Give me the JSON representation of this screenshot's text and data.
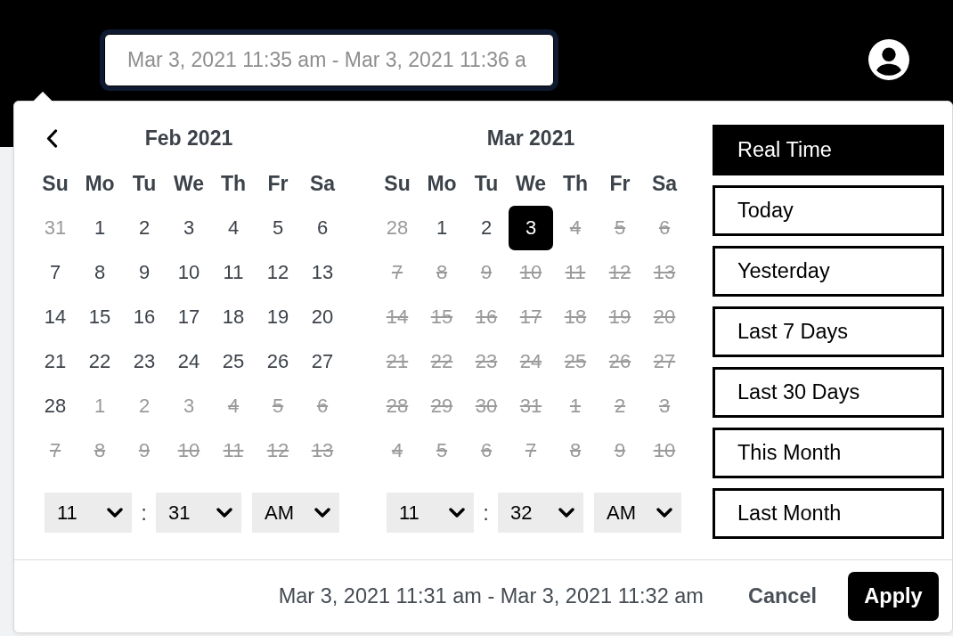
{
  "header": {
    "range_field": {
      "placeholder": "Mar 3, 2021 11:35 am - Mar 3, 2021 11:36 a"
    }
  },
  "picker": {
    "calendars": [
      {
        "has_prev": true,
        "title": "Feb 2021",
        "weekdays": [
          "Su",
          "Mo",
          "Tu",
          "We",
          "Th",
          "Fr",
          "Sa"
        ],
        "days": [
          {
            "label": "31",
            "outside": true,
            "disabled": false,
            "selected": false
          },
          {
            "label": "1",
            "outside": false,
            "disabled": false,
            "selected": false
          },
          {
            "label": "2",
            "outside": false,
            "disabled": false,
            "selected": false
          },
          {
            "label": "3",
            "outside": false,
            "disabled": false,
            "selected": false
          },
          {
            "label": "4",
            "outside": false,
            "disabled": false,
            "selected": false
          },
          {
            "label": "5",
            "outside": false,
            "disabled": false,
            "selected": false
          },
          {
            "label": "6",
            "outside": false,
            "disabled": false,
            "selected": false
          },
          {
            "label": "7",
            "outside": false,
            "disabled": false,
            "selected": false
          },
          {
            "label": "8",
            "outside": false,
            "disabled": false,
            "selected": false
          },
          {
            "label": "9",
            "outside": false,
            "disabled": false,
            "selected": false
          },
          {
            "label": "10",
            "outside": false,
            "disabled": false,
            "selected": false
          },
          {
            "label": "11",
            "outside": false,
            "disabled": false,
            "selected": false
          },
          {
            "label": "12",
            "outside": false,
            "disabled": false,
            "selected": false
          },
          {
            "label": "13",
            "outside": false,
            "disabled": false,
            "selected": false
          },
          {
            "label": "14",
            "outside": false,
            "disabled": false,
            "selected": false
          },
          {
            "label": "15",
            "outside": false,
            "disabled": false,
            "selected": false
          },
          {
            "label": "16",
            "outside": false,
            "disabled": false,
            "selected": false
          },
          {
            "label": "17",
            "outside": false,
            "disabled": false,
            "selected": false
          },
          {
            "label": "18",
            "outside": false,
            "disabled": false,
            "selected": false
          },
          {
            "label": "19",
            "outside": false,
            "disabled": false,
            "selected": false
          },
          {
            "label": "20",
            "outside": false,
            "disabled": false,
            "selected": false
          },
          {
            "label": "21",
            "outside": false,
            "disabled": false,
            "selected": false
          },
          {
            "label": "22",
            "outside": false,
            "disabled": false,
            "selected": false
          },
          {
            "label": "23",
            "outside": false,
            "disabled": false,
            "selected": false
          },
          {
            "label": "24",
            "outside": false,
            "disabled": false,
            "selected": false
          },
          {
            "label": "25",
            "outside": false,
            "disabled": false,
            "selected": false
          },
          {
            "label": "26",
            "outside": false,
            "disabled": false,
            "selected": false
          },
          {
            "label": "27",
            "outside": false,
            "disabled": false,
            "selected": false
          },
          {
            "label": "28",
            "outside": false,
            "disabled": false,
            "selected": false
          },
          {
            "label": "1",
            "outside": true,
            "disabled": false,
            "selected": false
          },
          {
            "label": "2",
            "outside": true,
            "disabled": false,
            "selected": false
          },
          {
            "label": "3",
            "outside": true,
            "disabled": false,
            "selected": false
          },
          {
            "label": "4",
            "outside": true,
            "disabled": true,
            "selected": false
          },
          {
            "label": "5",
            "outside": true,
            "disabled": true,
            "selected": false
          },
          {
            "label": "6",
            "outside": true,
            "disabled": true,
            "selected": false
          },
          {
            "label": "7",
            "outside": true,
            "disabled": true,
            "selected": false
          },
          {
            "label": "8",
            "outside": true,
            "disabled": true,
            "selected": false
          },
          {
            "label": "9",
            "outside": true,
            "disabled": true,
            "selected": false
          },
          {
            "label": "10",
            "outside": true,
            "disabled": true,
            "selected": false
          },
          {
            "label": "11",
            "outside": true,
            "disabled": true,
            "selected": false
          },
          {
            "label": "12",
            "outside": true,
            "disabled": true,
            "selected": false
          },
          {
            "label": "13",
            "outside": true,
            "disabled": true,
            "selected": false
          }
        ],
        "time": {
          "hour": "11",
          "separator": ":",
          "minute": "31",
          "period": "AM"
        }
      },
      {
        "has_prev": false,
        "title": "Mar 2021",
        "weekdays": [
          "Su",
          "Mo",
          "Tu",
          "We",
          "Th",
          "Fr",
          "Sa"
        ],
        "days": [
          {
            "label": "28",
            "outside": true,
            "disabled": false,
            "selected": false
          },
          {
            "label": "1",
            "outside": false,
            "disabled": false,
            "selected": false
          },
          {
            "label": "2",
            "outside": false,
            "disabled": false,
            "selected": false
          },
          {
            "label": "3",
            "outside": false,
            "disabled": false,
            "selected": true
          },
          {
            "label": "4",
            "outside": false,
            "disabled": true,
            "selected": false
          },
          {
            "label": "5",
            "outside": false,
            "disabled": true,
            "selected": false
          },
          {
            "label": "6",
            "outside": false,
            "disabled": true,
            "selected": false
          },
          {
            "label": "7",
            "outside": false,
            "disabled": true,
            "selected": false
          },
          {
            "label": "8",
            "outside": false,
            "disabled": true,
            "selected": false
          },
          {
            "label": "9",
            "outside": false,
            "disabled": true,
            "selected": false
          },
          {
            "label": "10",
            "outside": false,
            "disabled": true,
            "selected": false
          },
          {
            "label": "11",
            "outside": false,
            "disabled": true,
            "selected": false
          },
          {
            "label": "12",
            "outside": false,
            "disabled": true,
            "selected": false
          },
          {
            "label": "13",
            "outside": false,
            "disabled": true,
            "selected": false
          },
          {
            "label": "14",
            "outside": false,
            "disabled": true,
            "selected": false
          },
          {
            "label": "15",
            "outside": false,
            "disabled": true,
            "selected": false
          },
          {
            "label": "16",
            "outside": false,
            "disabled": true,
            "selected": false
          },
          {
            "label": "17",
            "outside": false,
            "disabled": true,
            "selected": false
          },
          {
            "label": "18",
            "outside": false,
            "disabled": true,
            "selected": false
          },
          {
            "label": "19",
            "outside": false,
            "disabled": true,
            "selected": false
          },
          {
            "label": "20",
            "outside": false,
            "disabled": true,
            "selected": false
          },
          {
            "label": "21",
            "outside": false,
            "disabled": true,
            "selected": false
          },
          {
            "label": "22",
            "outside": false,
            "disabled": true,
            "selected": false
          },
          {
            "label": "23",
            "outside": false,
            "disabled": true,
            "selected": false
          },
          {
            "label": "24",
            "outside": false,
            "disabled": true,
            "selected": false
          },
          {
            "label": "25",
            "outside": false,
            "disabled": true,
            "selected": false
          },
          {
            "label": "26",
            "outside": false,
            "disabled": true,
            "selected": false
          },
          {
            "label": "27",
            "outside": false,
            "disabled": true,
            "selected": false
          },
          {
            "label": "28",
            "outside": false,
            "disabled": true,
            "selected": false
          },
          {
            "label": "29",
            "outside": false,
            "disabled": true,
            "selected": false
          },
          {
            "label": "30",
            "outside": false,
            "disabled": true,
            "selected": false
          },
          {
            "label": "31",
            "outside": false,
            "disabled": true,
            "selected": false
          },
          {
            "label": "1",
            "outside": true,
            "disabled": true,
            "selected": false
          },
          {
            "label": "2",
            "outside": true,
            "disabled": true,
            "selected": false
          },
          {
            "label": "3",
            "outside": true,
            "disabled": true,
            "selected": false
          },
          {
            "label": "4",
            "outside": true,
            "disabled": true,
            "selected": false
          },
          {
            "label": "5",
            "outside": true,
            "disabled": true,
            "selected": false
          },
          {
            "label": "6",
            "outside": true,
            "disabled": true,
            "selected": false
          },
          {
            "label": "7",
            "outside": true,
            "disabled": true,
            "selected": false
          },
          {
            "label": "8",
            "outside": true,
            "disabled": true,
            "selected": false
          },
          {
            "label": "9",
            "outside": true,
            "disabled": true,
            "selected": false
          },
          {
            "label": "10",
            "outside": true,
            "disabled": true,
            "selected": false
          }
        ],
        "time": {
          "hour": "11",
          "separator": ":",
          "minute": "32",
          "period": "AM"
        }
      }
    ],
    "presets": [
      {
        "label": "Real Time",
        "selected": true
      },
      {
        "label": "Today",
        "selected": false
      },
      {
        "label": "Yesterday",
        "selected": false
      },
      {
        "label": "Last 7 Days",
        "selected": false
      },
      {
        "label": "Last 30 Days",
        "selected": false
      },
      {
        "label": "This Month",
        "selected": false
      },
      {
        "label": "Last Month",
        "selected": false
      }
    ],
    "footer": {
      "summary": "Mar 3, 2021 11:31 am - Mar 3, 2021 11:32 am",
      "cancel": "Cancel",
      "apply": "Apply"
    }
  }
}
